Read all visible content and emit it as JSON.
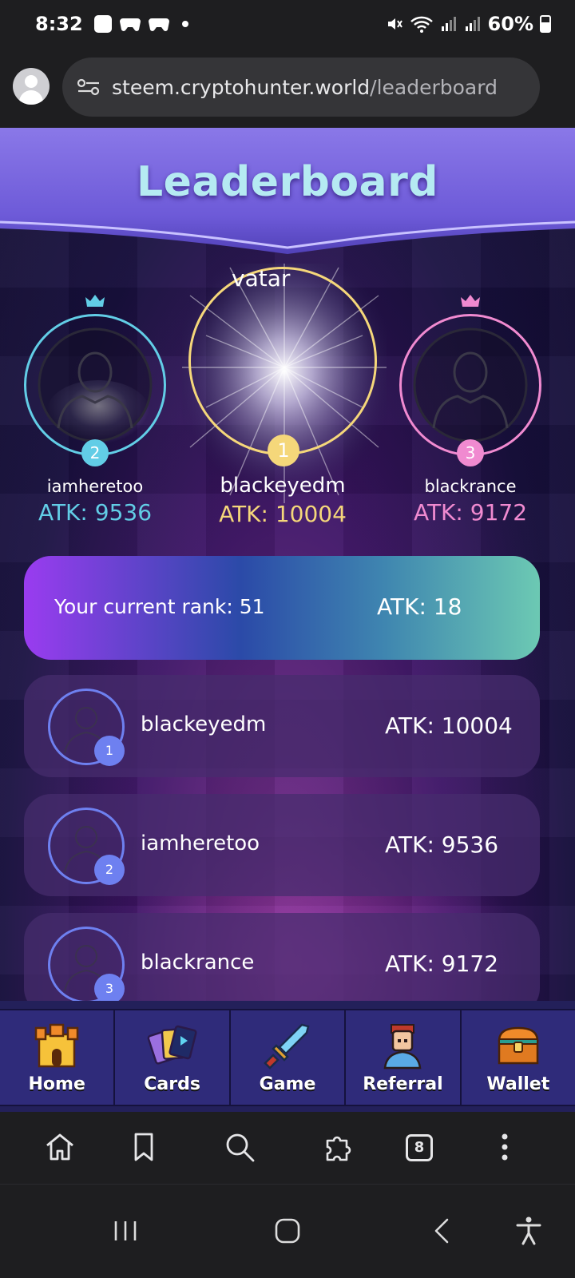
{
  "status_bar": {
    "time": "8:32",
    "battery": "60%"
  },
  "browser": {
    "url_host": "steem.cryptohunter.world",
    "url_path": "/leaderboard"
  },
  "page": {
    "title": "Leaderboard",
    "podium": [
      {
        "rank": "2",
        "name": "iamheretoo",
        "atk": "ATK: 9536",
        "color": "#62cde6"
      },
      {
        "rank": "1",
        "name": "blackeyedm",
        "atk": "ATK: 10004",
        "color": "#f5d77a",
        "broken_image_text": "vatar"
      },
      {
        "rank": "3",
        "name": "blackrance",
        "atk": "ATK: 9172",
        "color": "#f08ad0"
      }
    ],
    "current_rank": {
      "label": "Your current rank: 51",
      "atk": "ATK: 18"
    },
    "rows": [
      {
        "rank": "1",
        "name": "blackeyedm",
        "atk": "ATK: 10004"
      },
      {
        "rank": "2",
        "name": "iamheretoo",
        "atk": "ATK: 9536"
      },
      {
        "rank": "3",
        "name": "blackrance",
        "atk": "ATK: 9172"
      }
    ]
  },
  "game_nav": [
    {
      "label": "Home",
      "icon": "castle-icon"
    },
    {
      "label": "Cards",
      "icon": "cards-icon"
    },
    {
      "label": "Game",
      "icon": "sword-icon"
    },
    {
      "label": "Referral",
      "icon": "person-icon"
    },
    {
      "label": "Wallet",
      "icon": "treasure-chest-icon"
    }
  ],
  "browser_toolbar": {
    "tab_count": "8"
  },
  "colors": {
    "accent_blue": "#6e80f0",
    "second_place": "#62cde6",
    "first_place": "#f5d77a",
    "third_place": "#f08ad0"
  }
}
